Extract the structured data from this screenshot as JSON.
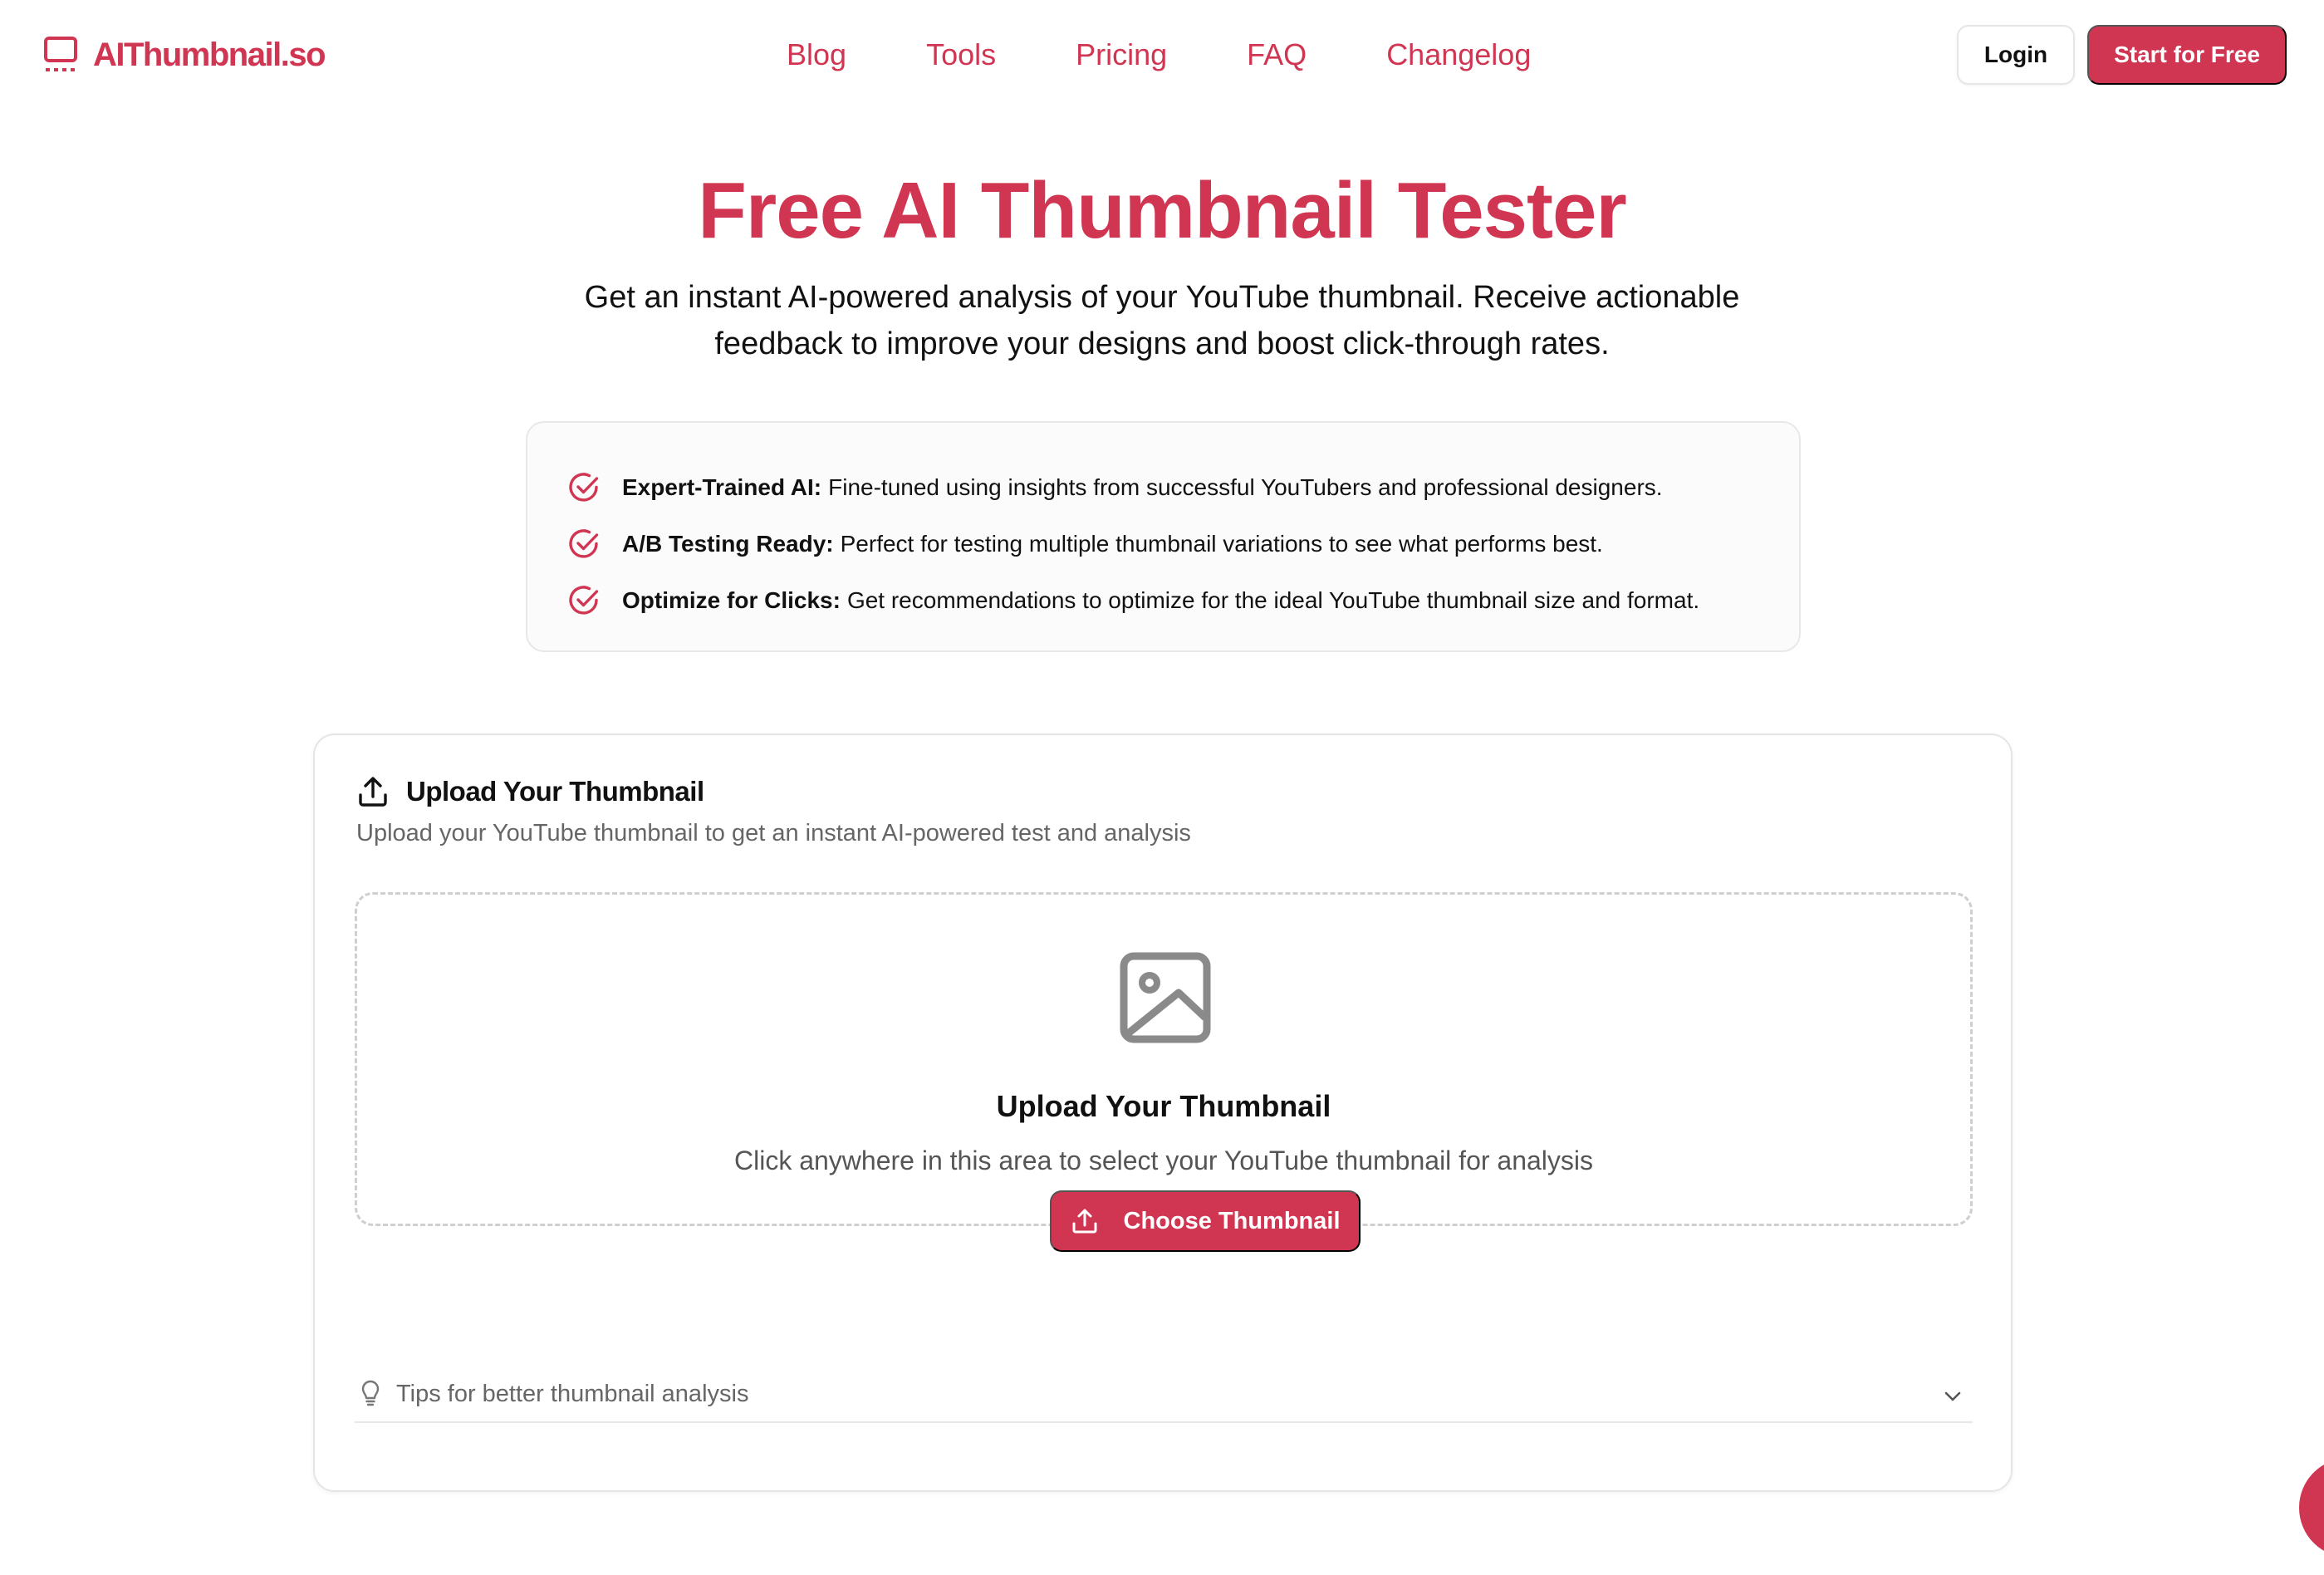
{
  "brand": {
    "name": "AIThumbnail.so",
    "accent_color": "#d03552",
    "logo_icon": "monitor-icon"
  },
  "nav": {
    "links": [
      "Blog",
      "Tools",
      "Pricing",
      "FAQ",
      "Changelog"
    ],
    "login_label": "Login",
    "cta_label": "Start for Free"
  },
  "hero": {
    "title": "Free AI Thumbnail Tester",
    "subtitle_line1": "Get an instant AI-powered analysis of your YouTube thumbnail. Receive actionable",
    "subtitle_line2": "feedback to improve your designs and boost click-through rates."
  },
  "features": [
    {
      "title": "Expert-Trained AI:",
      "text": "Fine-tuned using insights from successful YouTubers and professional designers.",
      "icon": "check-circle-icon"
    },
    {
      "title": "A/B Testing Ready:",
      "text": "Perfect for testing multiple thumbnail variations to see what performs best.",
      "icon": "check-circle-icon"
    },
    {
      "title": "Optimize for Clicks:",
      "text": "Get recommendations to optimize for the ideal YouTube thumbnail size and format.",
      "icon": "check-circle-icon"
    }
  ],
  "upload_card": {
    "title": "Upload Your Thumbnail",
    "description": "Upload your YouTube thumbnail to get an instant AI-powered test and analysis",
    "header_icon": "upload-icon",
    "dropzone": {
      "icon": "image-icon",
      "title": "Upload Your Thumbnail",
      "description": "Click anywhere in this area to select your YouTube thumbnail for analysis",
      "button_label": "Choose Thumbnail"
    },
    "tips": {
      "label": "Tips for better thumbnail analysis",
      "icon": "lightbulb-icon",
      "chevron_icon": "chevron-down-icon"
    }
  }
}
